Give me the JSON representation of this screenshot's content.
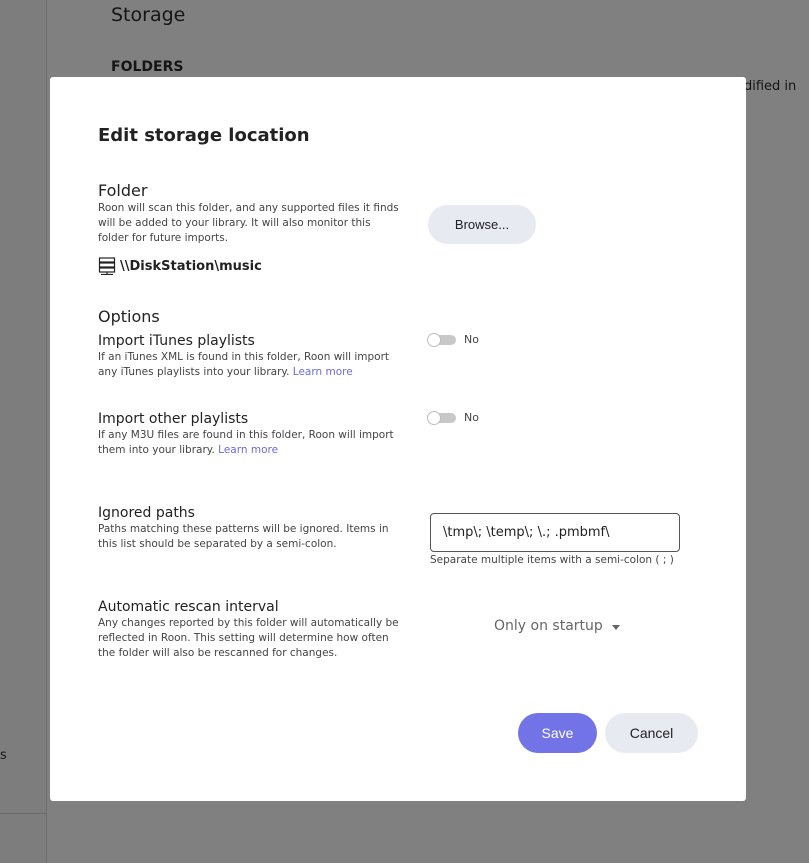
{
  "background": {
    "title": "Storage",
    "subtitle": "FOLDERS",
    "column_fragment": "odified in",
    "sidebar_fragment": "s"
  },
  "modal": {
    "title": "Edit storage location",
    "folder": {
      "heading": "Folder",
      "description": "Roon will scan this folder, and any supported files it finds will be added to your library. It will also monitor this folder for future imports.",
      "browse_label": "Browse...",
      "path": "\\\\DiskStation\\music",
      "path_icon": "server-icon"
    },
    "options": {
      "heading": "Options",
      "itunes": {
        "title": "Import iTunes playlists",
        "description": "If an iTunes XML is found in this folder, Roon will import any iTunes playlists into your library.",
        "link": "Learn more",
        "toggle_value": "No"
      },
      "other": {
        "title": "Import other playlists",
        "description": "If any M3U files are found in this folder, Roon will import them into your library.",
        "link": "Learn more",
        "toggle_value": "No"
      }
    },
    "ignored_paths": {
      "title": "Ignored paths",
      "description": "Paths matching these patterns will be ignored. Items in this list should be separated by a semi-colon.",
      "value": "\\tmp\\; \\temp\\; \\.; .pmbmf\\",
      "hint": "Separate multiple items with a semi-colon ( ; )"
    },
    "rescan": {
      "title": "Automatic rescan interval",
      "description": "Any changes reported by this folder will automatically be reflected in Roon. This setting will determine how often the folder will also be rescanned for changes.",
      "selected": "Only on startup"
    },
    "save_label": "Save",
    "cancel_label": "Cancel"
  },
  "colors": {
    "accent": "#7373e8",
    "secondary_button": "#e8eaf2",
    "link": "#6b6bd8"
  }
}
